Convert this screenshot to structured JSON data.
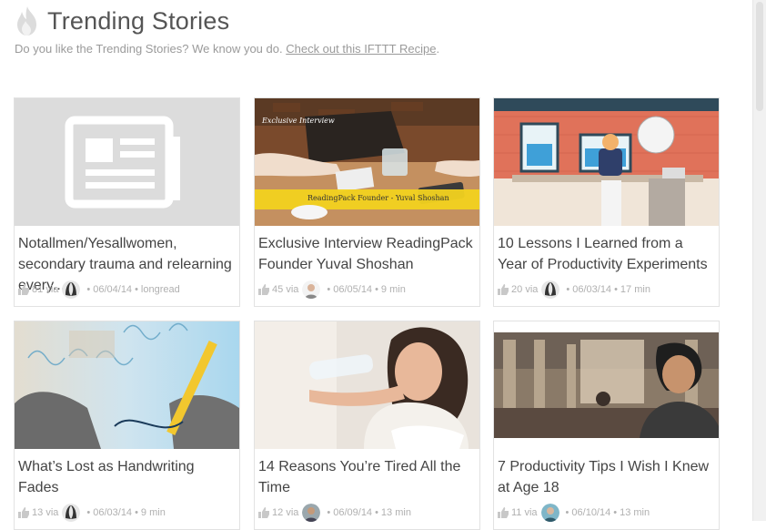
{
  "header": {
    "title": "Trending Stories",
    "subtitle_text": "Do you like the Trending Stories? We know you do.",
    "subtitle_link": "Check out this IFTTT Recipe",
    "subtitle_end": "."
  },
  "cards": [
    {
      "title": "Notallmen/Yesallwomen, secondary trauma and relearning every...",
      "likes": "81",
      "via": "via",
      "date": "06/04/14",
      "extra": "longread"
    },
    {
      "title": "Exclusive Interview ReadingPack Founder Yuval Shoshan",
      "likes": "45",
      "via": "via",
      "date": "06/05/14",
      "extra": "9 min",
      "image_text": "Exclusive Interview",
      "image_caption": "ReadingPack Founder - Yuval Shoshan"
    },
    {
      "title": "10 Lessons I Learned from a Year of Productivity Experiments",
      "likes": "20",
      "via": "via",
      "date": "06/03/14",
      "extra": "17 min"
    },
    {
      "title": "What’s Lost as Handwriting Fades",
      "likes": "13",
      "via": "via",
      "date": "06/03/14",
      "extra": "9 min"
    },
    {
      "title": "14 Reasons You’re Tired All the Time",
      "likes": "12",
      "via": "via",
      "date": "06/09/14",
      "extra": "13 min"
    },
    {
      "title": "7 Productivity Tips I Wish I Knew at Age 18",
      "likes": "11",
      "via": "via",
      "date": "06/10/14",
      "extra": "13 min"
    }
  ],
  "dot": "•",
  "colors": {
    "title": "#555555",
    "muted": "#9a9a9a",
    "placeholder_bg": "#dcdcdc",
    "accent_yellow": "#f2d21f"
  }
}
